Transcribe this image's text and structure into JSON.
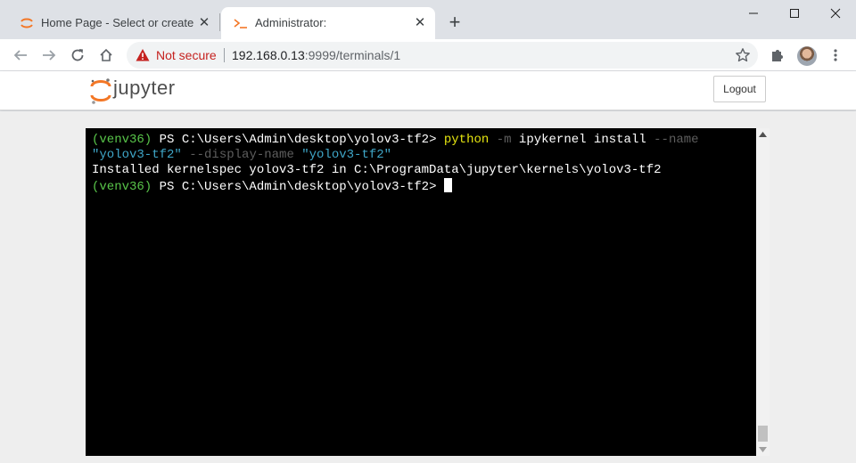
{
  "browser": {
    "tabs": [
      {
        "title": "Home Page - Select or create a n",
        "favicon": "jupyter-favicon",
        "active": false
      },
      {
        "title": "Administrator:",
        "favicon": "terminal-favicon",
        "active": true
      }
    ],
    "new_tab_symbol": "+",
    "close_symbol": "✕",
    "security_label": "Not secure",
    "url_host": "192.168.0.13",
    "url_path": ":9999/terminals/1",
    "accent_colors": {
      "not_secure": "#c5221f",
      "jupyter_orange": "#f37726"
    }
  },
  "jupyter": {
    "logo_text": "jupyter",
    "logout_label": "Logout"
  },
  "terminal": {
    "line1": {
      "prompt_env": "(venv36)",
      "prompt_path": " PS C:\\Users\\Admin\\desktop\\yolov3-tf2> ",
      "cmd": "python",
      "flag_m": " -m",
      "args": " ipykernel install",
      "flag_name": " --name"
    },
    "line2": {
      "name_value": "\"yolov3-tf2\"",
      "flag_display": " --display-name ",
      "display_value": "\"yolov3-tf2\""
    },
    "line3": "Installed kernelspec yolov3-tf2 in C:\\ProgramData\\jupyter\\kernels\\yolov3-tf2",
    "line4": {
      "prompt_env": "(venv36)",
      "prompt_path": " PS C:\\Users\\Admin\\desktop\\yolov3-tf2> "
    }
  }
}
